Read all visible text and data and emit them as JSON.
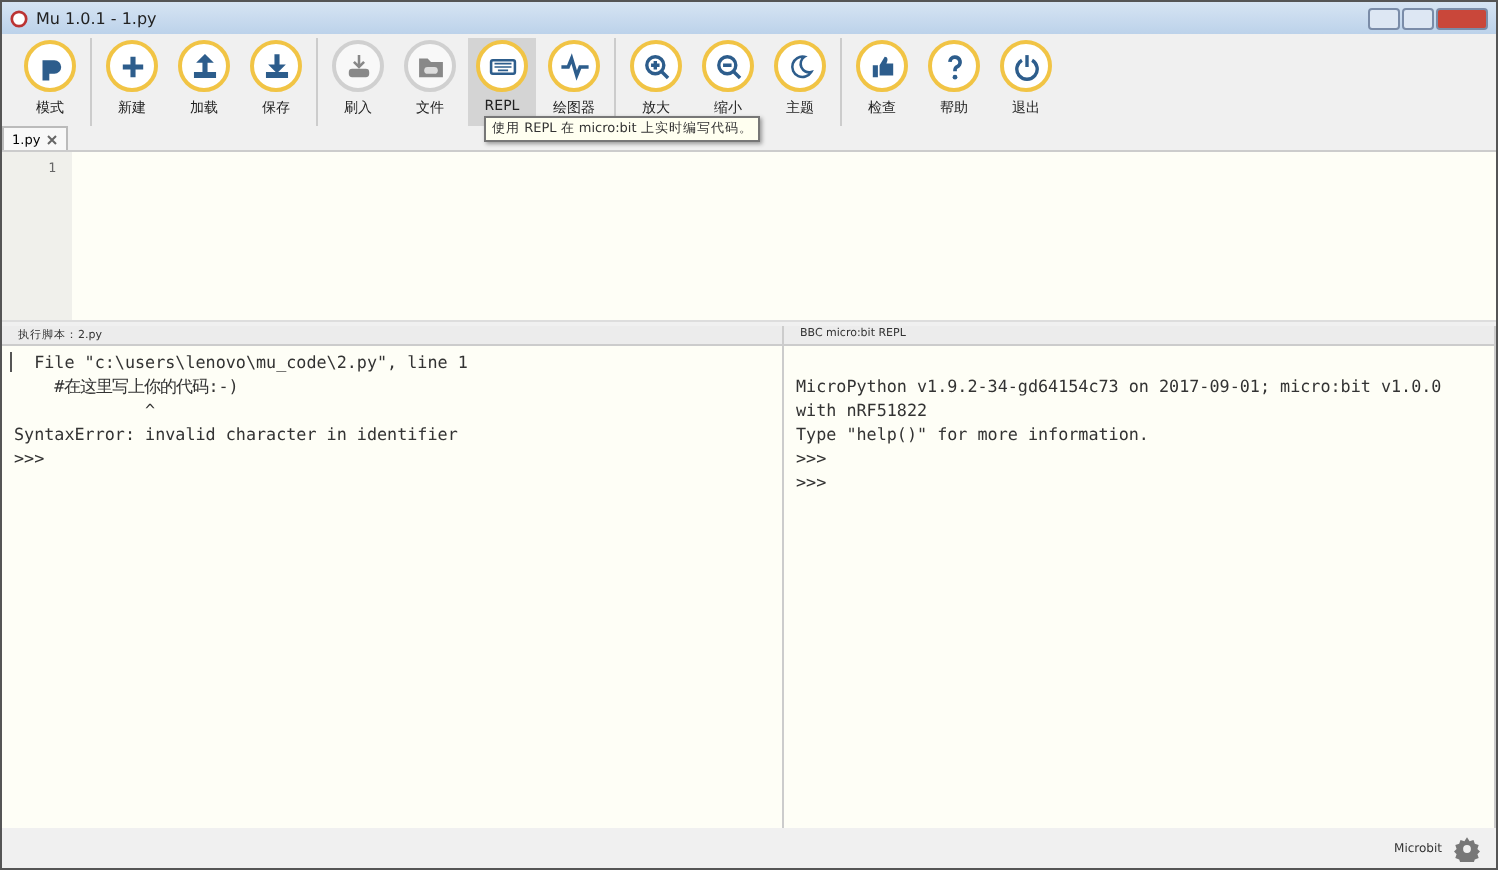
{
  "window": {
    "title": "Mu 1.0.1 - 1.py"
  },
  "toolbar": {
    "groups": [
      [
        {
          "label": "模式",
          "disabled": false,
          "selected": false
        }
      ],
      [
        {
          "label": "新建",
          "disabled": false,
          "selected": false
        },
        {
          "label": "加载",
          "disabled": false,
          "selected": false
        },
        {
          "label": "保存",
          "disabled": false,
          "selected": false
        }
      ],
      [
        {
          "label": "刷入",
          "disabled": true,
          "selected": false
        },
        {
          "label": "文件",
          "disabled": true,
          "selected": false
        },
        {
          "label": "REPL",
          "disabled": false,
          "selected": true,
          "tooltip": "使用 REPL 在 micro:bit 上实时编写代码。"
        },
        {
          "label": "绘图器",
          "disabled": false,
          "selected": false
        }
      ],
      [
        {
          "label": "放大",
          "disabled": false,
          "selected": false
        },
        {
          "label": "缩小",
          "disabled": false,
          "selected": false
        },
        {
          "label": "主题",
          "disabled": false,
          "selected": false
        }
      ],
      [
        {
          "label": "检查",
          "disabled": false,
          "selected": false
        },
        {
          "label": "帮助",
          "disabled": false,
          "selected": false
        },
        {
          "label": "退出",
          "disabled": false,
          "selected": false
        }
      ]
    ]
  },
  "tabs": [
    {
      "label": "1.py",
      "selected": true
    }
  ],
  "editor": {
    "line_numbers": [
      "1"
    ]
  },
  "panes": [
    {
      "title": "执行脚本：2.py",
      "lines": [
        "  File \"c:\\users\\lenovo\\mu_code\\2.py\", line 1",
        "    #在这里写上你的代码:-)",
        "             ^",
        "SyntaxError: invalid character in identifier",
        ">>>"
      ]
    },
    {
      "title": "BBC micro:bit REPL",
      "lines": [
        "MicroPython v1.9.2-34-gd64154c73 on 2017-09-01; micro:bit v1.0.0",
        "with nRF51822",
        "Type \"help()\" for more information.",
        ">>>",
        ">>>"
      ]
    }
  ],
  "status_bar": {
    "mode": "Microbit"
  }
}
